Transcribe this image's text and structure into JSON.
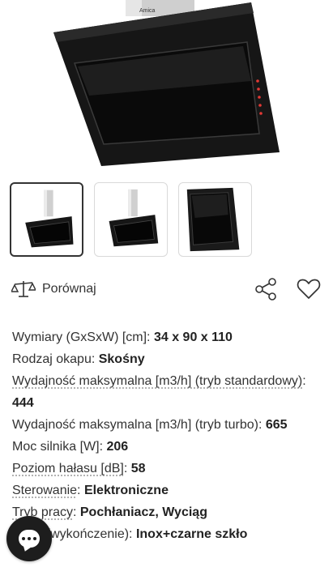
{
  "product": {
    "brand_mark": "Amica",
    "colors": {
      "glass": "#1a1a1a",
      "steel": "#d8d8d8",
      "accent_led": "#e53935"
    }
  },
  "gallery": {
    "thumbnails": [
      {
        "name": "hood-front-view",
        "active": true
      },
      {
        "name": "hood-side-view",
        "active": false
      },
      {
        "name": "hood-glass-detail",
        "active": false
      }
    ]
  },
  "actions": {
    "compare_label": "Porównaj",
    "share_icon": "share-icon",
    "favorite_icon": "heart-icon",
    "compare_icon": "scales-icon"
  },
  "specs": [
    {
      "key": "Wymiary (GxSxW) [cm]: ",
      "value": "34 x 90 x 110",
      "link": false
    },
    {
      "key": "Rodzaj okapu: ",
      "value": "Skośny",
      "link": false
    },
    {
      "key": "Wydajność maksymalna [m3/h] (tryb standardowy)",
      "after": ": ",
      "value": "444",
      "link": true
    },
    {
      "key": "Wydajność maksymalna [m3/h] (tryb turbo): ",
      "value": "665",
      "link": false
    },
    {
      "key": "Moc silnika [W]: ",
      "value": "206",
      "link": false
    },
    {
      "key": "Poziom hałasu [dB]",
      "after": ": ",
      "value": "58",
      "link": true
    },
    {
      "key": "Sterowanie",
      "after": ": ",
      "value": "Elektroniczne",
      "link": true
    },
    {
      "key": "Tryb pracy",
      "after": ": ",
      "value": "Pochłaniacz, Wyciąg",
      "link": true
    },
    {
      "key": "Kolor (wykończenie): ",
      "value": "Inox+czarne szkło",
      "link": false
    }
  ],
  "chat": {
    "icon": "chat-bubble-icon",
    "background": "#1d1d1d"
  }
}
